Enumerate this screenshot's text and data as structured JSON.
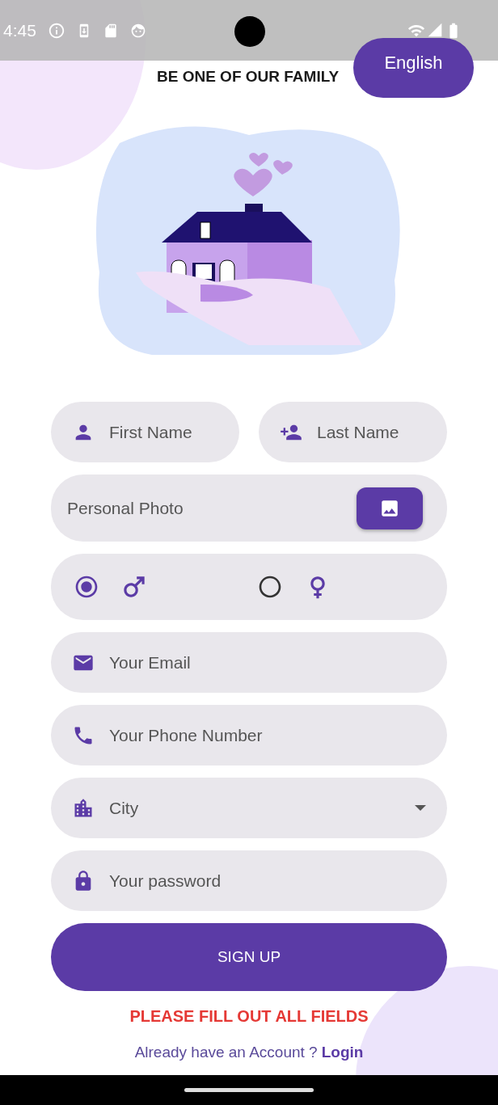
{
  "status_bar": {
    "time": "4:45"
  },
  "header": {
    "title": "BE ONE OF OUR FAMILY",
    "language_button": "English"
  },
  "name_fields": [
    {
      "kind": "first",
      "placeholder": "First Name"
    },
    {
      "kind": "last",
      "placeholder": "Last Name"
    }
  ],
  "photo_field": {
    "label": "Personal Photo"
  },
  "gender": [
    {
      "kind": "male",
      "selected": true
    },
    {
      "kind": "female",
      "selected": false
    }
  ],
  "fields": [
    {
      "kind": "email",
      "placeholder": "Your Email"
    },
    {
      "kind": "phone",
      "placeholder": "Your Phone Number"
    },
    {
      "kind": "city",
      "placeholder": "City"
    },
    {
      "kind": "password",
      "placeholder": "Your password"
    }
  ],
  "signup_button": "SIGN UP",
  "error_message": "PLEASE FILL OUT ALL FIELDS",
  "footer": {
    "text": "Already have an Account ?",
    "link": "Login"
  }
}
